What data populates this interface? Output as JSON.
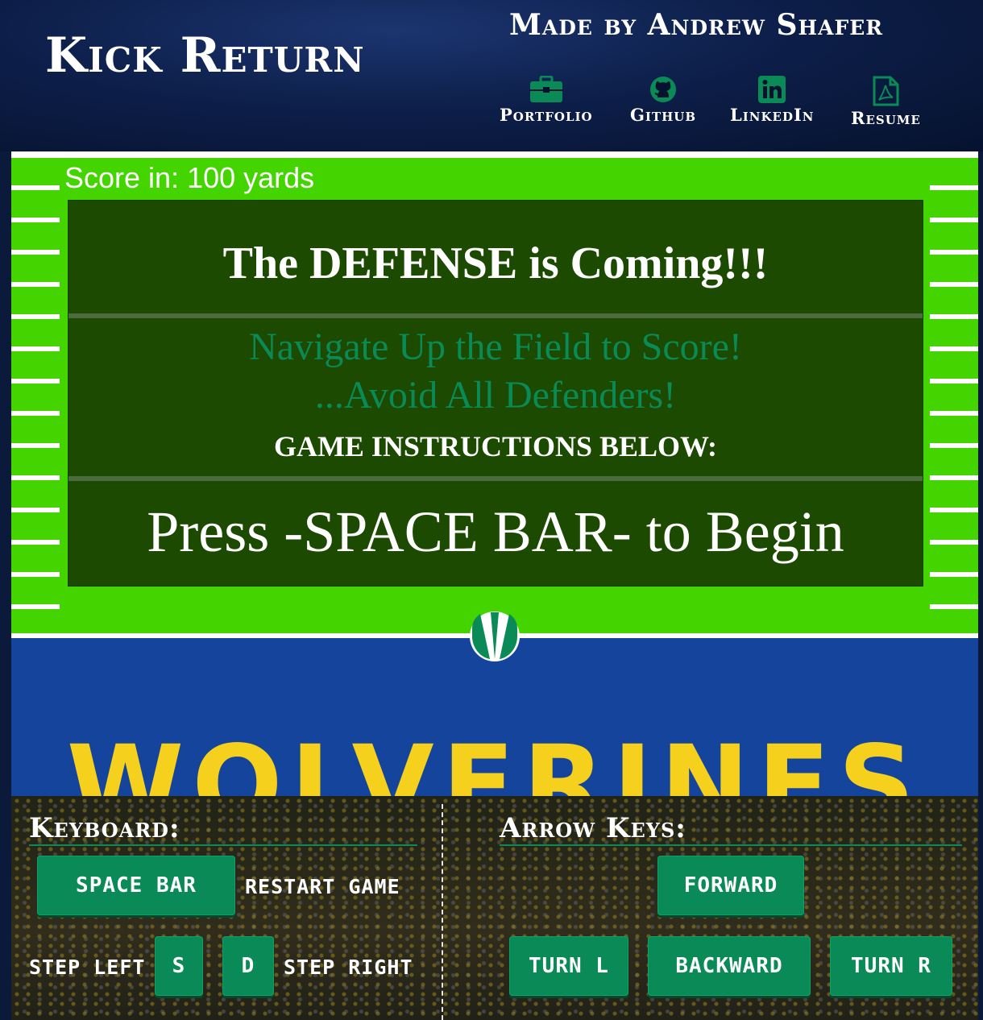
{
  "header": {
    "title": "Kick Return",
    "made_by": "Made by Andrew Shafer",
    "links": [
      {
        "label": "Portfolio",
        "icon": "briefcase-icon"
      },
      {
        "label": "Github",
        "icon": "github-icon"
      },
      {
        "label": "LinkedIn",
        "icon": "linkedin-icon"
      },
      {
        "label": "Resume",
        "icon": "pdf-icon"
      }
    ],
    "icon_color": "#0a8a56"
  },
  "game": {
    "score_text": "Score in: 100 yards",
    "headline": "The DEFENSE is Coming!!!",
    "line1": "Navigate Up the Field to Score!",
    "line2": "...Avoid All Defenders!",
    "instructions": "GAME INSTRUCTIONS BELOW:",
    "start_prompt": "Press -SPACE BAR- to Begin",
    "endzone_text": "WOLVERINES",
    "colors": {
      "field": "#44d400",
      "panel": "#1b4a00",
      "endzone": "#14449b",
      "endzone_text": "#f5d01c"
    }
  },
  "controls": {
    "keyboard": {
      "heading": "Keyboard:",
      "space_key": "SPACE BAR",
      "space_action": "RESTART GAME",
      "left_action": "STEP LEFT",
      "left_key": "S",
      "right_key": "D",
      "right_action": "STEP RIGHT"
    },
    "arrows": {
      "heading": "Arrow Keys:",
      "forward": "FORWARD",
      "turn_left": "TURN L",
      "backward": "BACKWARD",
      "turn_right": "TURN R"
    },
    "key_color": "#0a8a56"
  }
}
